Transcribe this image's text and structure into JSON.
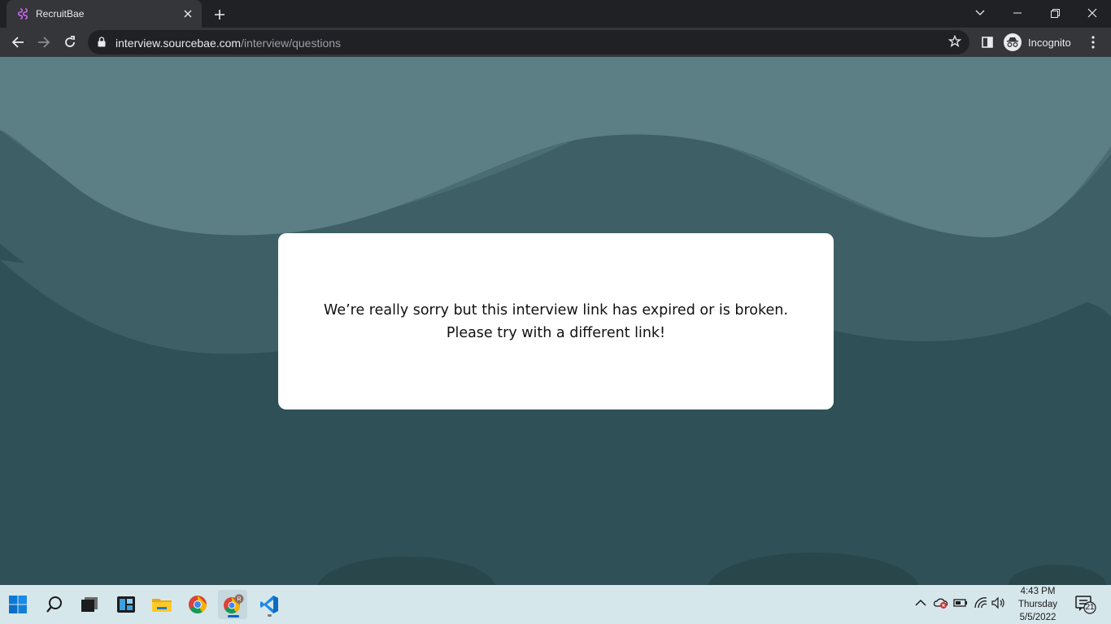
{
  "browser": {
    "tab_title": "RecruitBae",
    "url_domain": "interview.sourcebae.com",
    "url_path": "/interview/questions",
    "profile_label": "Incognito"
  },
  "page": {
    "message": "We’re really sorry but this interview link has expired or is broken. Please try with a different link!"
  },
  "taskbar": {
    "time": "4:43 PM",
    "day": "Thursday",
    "date": "5/5/2022",
    "notification_count": "21",
    "apps": [
      "start-icon",
      "search-icon",
      "task-view-icon",
      "widgets-icon",
      "file-explorer-icon",
      "chrome-icon",
      "chrome-incognito-icon",
      "vscode-icon"
    ]
  },
  "colors": {
    "titlebar": "#202124",
    "toolbar": "#35363a",
    "wave_light": "#5c7f85",
    "wave_mid": "#4a6d73",
    "wave_dark": "#3d5f65",
    "page_bg": "#2e5056",
    "taskbar": "#d6e7ec",
    "accent_purple": "#c063e0"
  }
}
